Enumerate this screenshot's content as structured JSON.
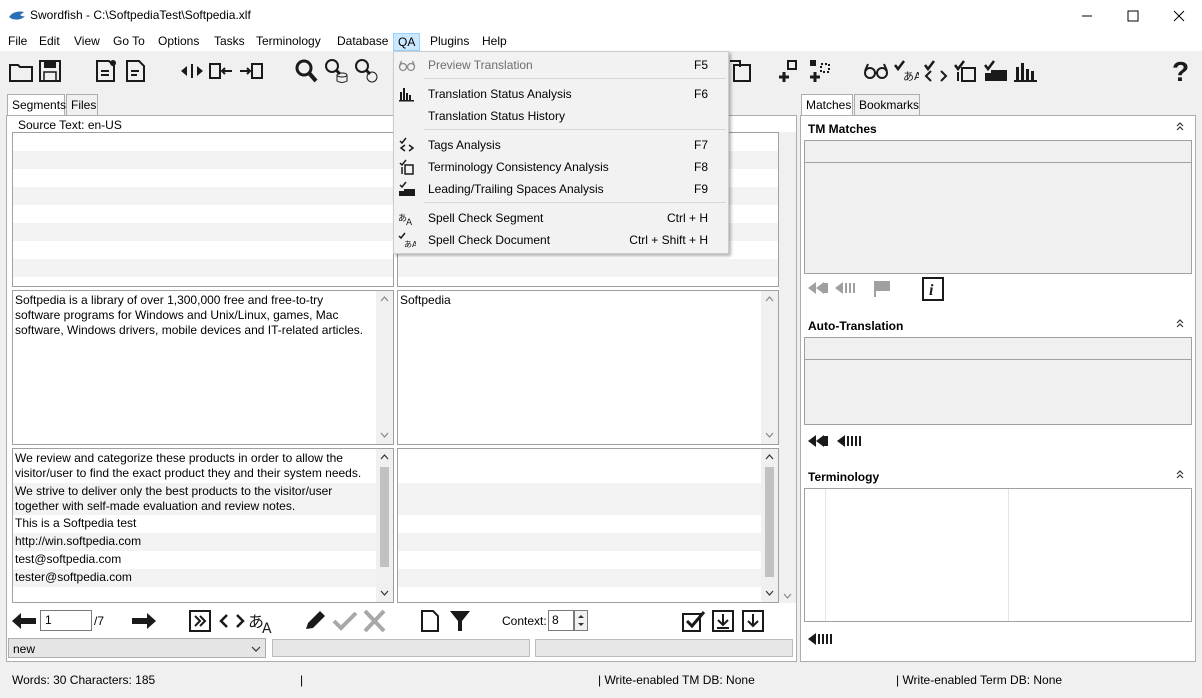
{
  "window": {
    "title": "Swordfish - C:\\SoftpediaTest\\Softpedia.xlf"
  },
  "menu": {
    "items": [
      "File",
      "Edit",
      "View",
      "Go To",
      "Options",
      "Tasks",
      "Terminology",
      "Database",
      "QA",
      "Plugins",
      "Help"
    ]
  },
  "qa_menu": {
    "items": [
      {
        "label": "Preview Translation",
        "key": "F5",
        "icon": "glasses-icon",
        "disabled": true
      },
      {
        "label": "Translation Status Analysis",
        "key": "F6",
        "icon": "bar-chart-icon"
      },
      {
        "label": "Translation Status History",
        "key": "",
        "icon": ""
      },
      {
        "label": "Tags Analysis",
        "key": "F7",
        "icon": "tags-icon"
      },
      {
        "label": "Terminology Consistency Analysis",
        "key": "F8",
        "icon": "terminology-check-icon"
      },
      {
        "label": "Leading/Trailing Spaces Analysis",
        "key": "F9",
        "icon": "spaces-check-icon"
      },
      {
        "label": "Spell Check Segment",
        "key": "Ctrl + H",
        "icon": "spell-segment-icon"
      },
      {
        "label": "Spell Check Document",
        "key": "Ctrl + Shift + H",
        "icon": "spell-document-icon"
      }
    ]
  },
  "left_tabs": [
    "Segments",
    "Files"
  ],
  "source_label": "Source Text: en-US",
  "segments": {
    "current_source": "Softpedia is a library of over 1,300,000 free and free-to-try software programs for Windows and Unix/Linux, games, Mac software, Windows drivers, mobile devices and IT-related articles.",
    "current_target": "Softpedia",
    "following": [
      "We review and categorize these products in order to allow the visitor/user to find the exact product they and their system needs.",
      "We strive to deliver only the best products to the visitor/user together with self-made evaluation and review notes.",
      "This is a Softpedia test",
      "http://win.softpedia.com",
      "test@softpedia.com",
      "tester@softpedia.com"
    ]
  },
  "navigation": {
    "segment_number": "1",
    "segment_total": "/7",
    "context_label": "Context:",
    "context_value": "8",
    "status_value": "new"
  },
  "right_tabs": [
    "Matches",
    "Bookmarks"
  ],
  "right_panels": {
    "tm_matches": "TM Matches",
    "auto_translation": "Auto-Translation",
    "terminology": "Terminology"
  },
  "statusbar": {
    "counts": "Words: 30 Characters: 185",
    "sep": "|",
    "tm_db": "| Write-enabled TM DB: None",
    "term_db": "| Write-enabled Term DB: None"
  },
  "colors": {
    "accent": "#cce8ff",
    "icon_dark": "#1a1a1a"
  }
}
